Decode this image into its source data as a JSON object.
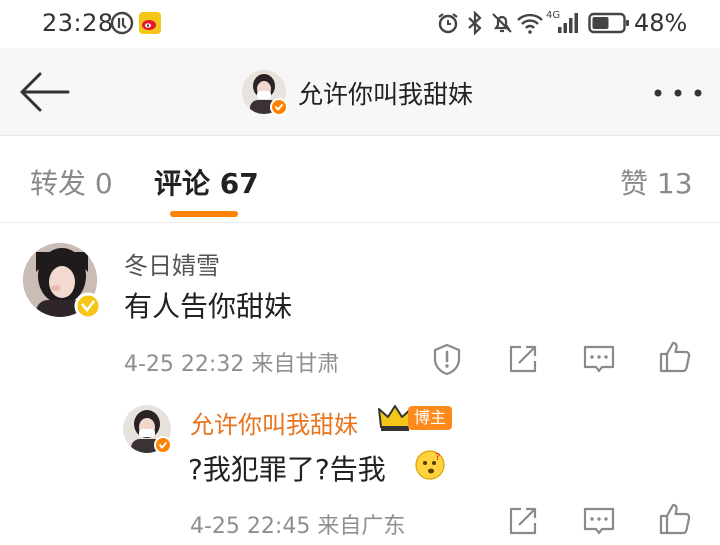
{
  "status_bar": {
    "time": "23:28",
    "battery_percent": "48%",
    "icons": [
      "sync-icon",
      "weibo-app-icon",
      "alarm-icon",
      "bluetooth-icon",
      "mute-icon",
      "wifi-icon",
      "signal-4g-icon",
      "battery-icon"
    ],
    "network_label": "4G"
  },
  "nav": {
    "title": "允许你叫我甜妹"
  },
  "tabs": {
    "repost": "转发 0",
    "comment": "评论 67",
    "like": "赞 13",
    "active": "comment",
    "accent_color": "#ff8200"
  },
  "comments": [
    {
      "username": "冬日婧雪",
      "text": "有人告你甜妹",
      "meta": "4-25 22:32 来自甘肃",
      "verified_color": "#f5c518"
    }
  ],
  "replies": [
    {
      "username": "允许你叫我甜妹",
      "badge": "博主",
      "text": "?我犯罪了?告我",
      "meta": "4-25 22:45 来自广东",
      "username_color": "#e8741e"
    }
  ]
}
